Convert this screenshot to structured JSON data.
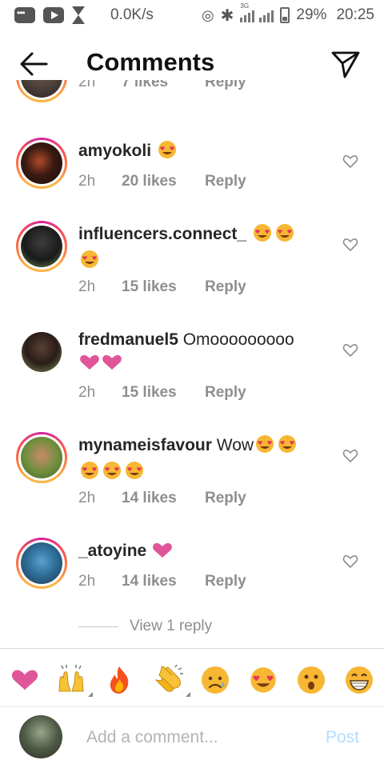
{
  "status_bar": {
    "speed": "0.0K/s",
    "network_tag": "3G",
    "battery": "29%",
    "time": "20:25"
  },
  "header": {
    "title": "Comments",
    "back_icon": "arrow-left-icon",
    "send_icon": "paper-plane-icon"
  },
  "partial_comment": {
    "time": "2h",
    "likes": "7 likes",
    "reply": "Reply"
  },
  "comments": [
    {
      "username": "amyokoli",
      "text": "",
      "emojis": [
        "heart-eyes",
        "",
        "",
        "",
        ""
      ],
      "time": "2h",
      "likes": "20 likes",
      "reply": "Reply"
    },
    {
      "username": "influencers.connect_",
      "text": "",
      "emojis": [
        "heart-eyes",
        "heart-eyes",
        "heart-eyes"
      ],
      "time": "2h",
      "likes": "15 likes",
      "reply": "Reply"
    },
    {
      "username": "fredmanuel5",
      "text": "Omooooooooo",
      "emojis": [
        "pink-heart",
        "pink-heart"
      ],
      "time": "2h",
      "likes": "15 likes",
      "reply": "Reply"
    },
    {
      "username": "mynameisfavour",
      "text": "Wow",
      "emojis": [
        "heart-eyes",
        "heart-eyes",
        "heart-eyes",
        "heart-eyes",
        "heart-eyes"
      ],
      "time": "2h",
      "likes": "14 likes",
      "reply": "Reply"
    },
    {
      "username": "_atoyine",
      "text": "",
      "emojis": [
        "pink-heart"
      ],
      "time": "2h",
      "likes": "14 likes",
      "reply": "Reply"
    }
  ],
  "view_replies": "View 1 reply",
  "quick_emojis": [
    "heart",
    "raised-hands",
    "fire",
    "clapping-hands",
    "sad-face",
    "heart-eyes",
    "surprised-face",
    "grinning-face"
  ],
  "composer": {
    "placeholder": "Add a comment...",
    "post_label": "Post"
  },
  "colors": {
    "text": "#262626",
    "meta": "#8e8e8e",
    "post_disabled": "#b3dbff",
    "story_ring": "#d6249f"
  }
}
